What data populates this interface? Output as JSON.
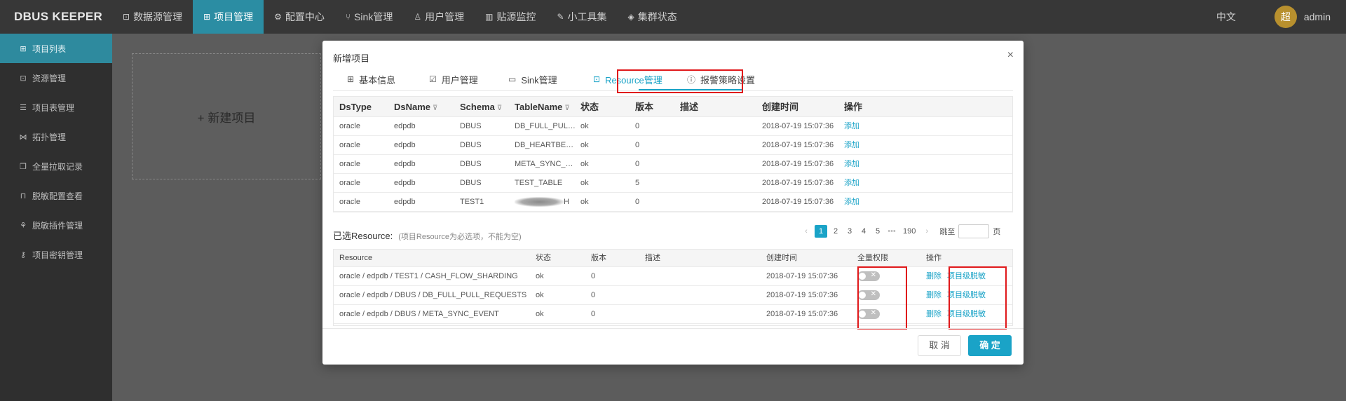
{
  "app": {
    "logo": "DBUS KEEPER",
    "lang": "中文",
    "avatar_char": "超",
    "user": "admin"
  },
  "nav": [
    {
      "icon": "database-icon",
      "glyph": "⊡",
      "label": "数据源管理"
    },
    {
      "icon": "grid-icon",
      "glyph": "⊞",
      "label": "项目管理",
      "active": true
    },
    {
      "icon": "gear-icon",
      "glyph": "⚙",
      "label": "配置中心"
    },
    {
      "icon": "fork-icon",
      "glyph": "⑂",
      "label": "Sink管理"
    },
    {
      "icon": "user-icon",
      "glyph": "♙",
      "label": "用户管理"
    },
    {
      "icon": "bar-chart-icon",
      "glyph": "▥",
      "label": "贴源监控"
    },
    {
      "icon": "wrench-icon",
      "glyph": "✎",
      "label": "小工具集"
    },
    {
      "icon": "shield-icon",
      "glyph": "◈",
      "label": "集群状态"
    }
  ],
  "sidebar": [
    {
      "icon": "grid-icon",
      "glyph": "⊞",
      "label": "项目列表",
      "active": true
    },
    {
      "icon": "database-icon",
      "glyph": "⊡",
      "label": "资源管理"
    },
    {
      "icon": "table-icon",
      "glyph": "☰",
      "label": "项目表管理"
    },
    {
      "icon": "topology-icon",
      "glyph": "⋈",
      "label": "拓扑管理"
    },
    {
      "icon": "copy-icon",
      "glyph": "❐",
      "label": "全量拉取记录"
    },
    {
      "icon": "lock-icon",
      "glyph": "⊓",
      "label": "脱敏配置查看"
    },
    {
      "icon": "plugin-icon",
      "glyph": "⚘",
      "label": "脱敏插件管理"
    },
    {
      "icon": "key-icon",
      "glyph": "⚷",
      "label": "项目密钥管理"
    }
  ],
  "main": {
    "new_project": "+ 新建项目"
  },
  "modal": {
    "title": "新增项目",
    "tabs": [
      {
        "icon": "grid-icon",
        "glyph": "⊞",
        "label": "基本信息"
      },
      {
        "icon": "user-edit-icon",
        "glyph": "☑",
        "label": "用户管理"
      },
      {
        "icon": "card-icon",
        "glyph": "▭",
        "label": "Sink管理"
      },
      {
        "icon": "database-icon",
        "glyph": "⊡",
        "label": "Resource管理",
        "active": true
      },
      {
        "icon": "info-icon",
        "glyph": "ⓘ",
        "label": "报警策略设置"
      }
    ],
    "resource_table": {
      "headers": [
        "DsType",
        "DsName",
        "Schema",
        "TableName",
        "状态",
        "版本",
        "描述",
        "创建时间",
        "操作"
      ],
      "rows": [
        [
          "oracle",
          "edpdb",
          "DBUS",
          "DB_FULL_PULL_REQUESTS",
          "ok",
          "0",
          "",
          "2018-07-19 15:07:36",
          "添加"
        ],
        [
          "oracle",
          "edpdb",
          "DBUS",
          "DB_HEARTBEAT_MONITOR",
          "ok",
          "0",
          "",
          "2018-07-19 15:07:36",
          "添加"
        ],
        [
          "oracle",
          "edpdb",
          "DBUS",
          "META_SYNC_EVENT",
          "ok",
          "0",
          "",
          "2018-07-19 15:07:36",
          "添加"
        ],
        [
          "oracle",
          "edpdb",
          "DBUS",
          "TEST_TABLE",
          "ok",
          "5",
          "",
          "2018-07-19 15:07:36",
          "添加"
        ],
        [
          "oracle",
          "edpdb",
          "TEST1",
          "H",
          "ok",
          "0",
          "",
          "2018-07-19 15:07:36",
          "添加"
        ]
      ]
    },
    "pager": {
      "prev": "‹",
      "pages": [
        "1",
        "2",
        "3",
        "4",
        "5"
      ],
      "ellipsis": "•••",
      "last": "190",
      "next": "›",
      "jump_label": "跳至",
      "page_unit": "页"
    },
    "selected": {
      "label": "已选Resource:",
      "hint": "(项目Resource为必选项，不能为空)",
      "headers": [
        "Resource",
        "状态",
        "版本",
        "描述",
        "创建时间",
        "全量权限",
        "操作"
      ],
      "rows": [
        {
          "resource": "oracle / edpdb / TEST1 / CASH_FLOW_SHARDING",
          "status": "ok",
          "version": "0",
          "desc": "",
          "time": "2018-07-19 15:07:36",
          "switch_on": false,
          "delete": "删除",
          "mask": "项目级脱敏"
        },
        {
          "resource": "oracle / edpdb / DBUS / DB_FULL_PULL_REQUESTS",
          "status": "ok",
          "version": "0",
          "desc": "",
          "time": "2018-07-19 15:07:36",
          "switch_on": false,
          "delete": "删除",
          "mask": "项目级脱敏"
        },
        {
          "resource": "oracle / edpdb / DBUS / META_SYNC_EVENT",
          "status": "ok",
          "version": "0",
          "desc": "",
          "time": "2018-07-19 15:07:36",
          "switch_on": false,
          "delete": "删除",
          "mask": "项目级脱敏"
        }
      ]
    },
    "buttons": {
      "cancel": "取 消",
      "ok": "确 定"
    },
    "close": "×"
  },
  "colors": {
    "accent": "#1aa3c7",
    "highlight": "#e0181a",
    "nav_active": "#2b8da3"
  }
}
